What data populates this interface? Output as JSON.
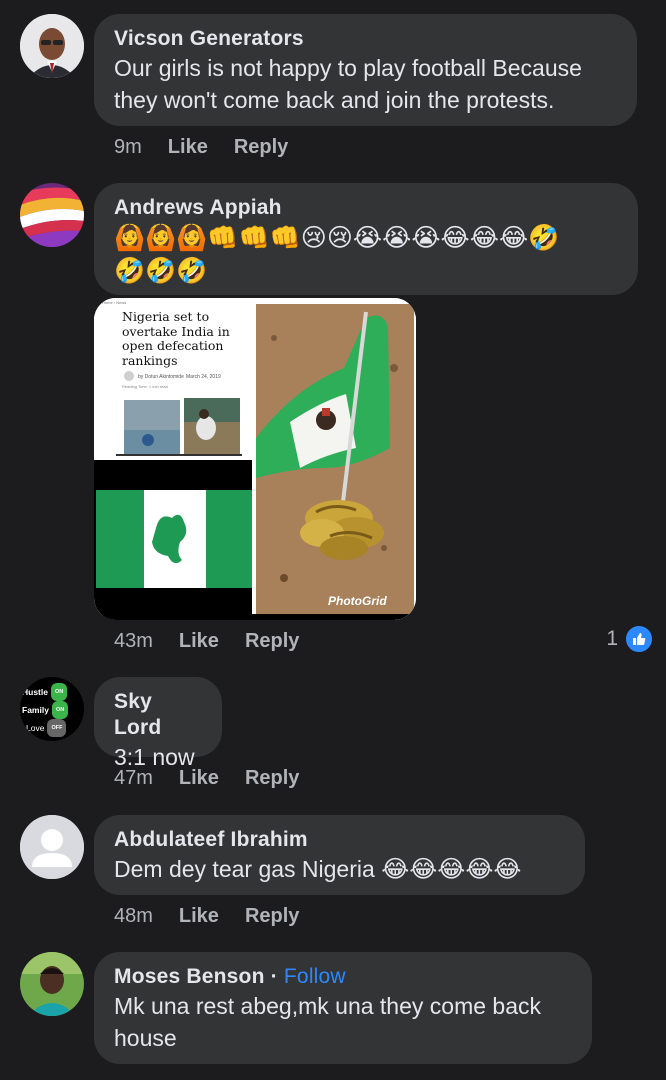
{
  "comments": [
    {
      "author": "Vicson Generators",
      "text_line1": "Our girls is not happy to play football Because",
      "text_line2": "they won't come back and join the protests.",
      "time": "9m",
      "like": "Like",
      "reply": "Reply"
    },
    {
      "author": "Andrews Appiah",
      "emoji_line1": "🙆🙆🙆👊👊👊😢😢😭😭😭😂😂😂🤣",
      "emoji_line2": "🤣🤣🤣",
      "time": "43m",
      "like": "Like",
      "reply": "Reply",
      "reaction_count": "1",
      "photo": {
        "article_breadcrumb": "Home › News",
        "headline": "Nigeria set to overtake India in open defecation rankings",
        "byline": "by Dotun Akintomide",
        "date": "March 24, 2019",
        "read_time": "Reading Time: 1 min read",
        "watermark": "PhotoGrid"
      }
    },
    {
      "author": "Sky Lord",
      "text_line1": "3:1 now",
      "time": "47m",
      "like": "Like",
      "reply": "Reply",
      "avatar_labels": [
        "Hustle",
        "Family",
        "Love"
      ],
      "avatar_toggles": [
        "ON",
        "ON",
        "OFF"
      ]
    },
    {
      "author": "Abdulateef Ibrahim",
      "text_line1": "Dem dey tear gas Nigeria",
      "emoji": "😂😂😂😂😂",
      "time": "48m",
      "like": "Like",
      "reply": "Reply"
    },
    {
      "author": "Moses Benson",
      "separator": "·",
      "follow": "Follow",
      "text_line1": "Mk una rest abeg,mk una they come back",
      "text_line2": "house"
    }
  ],
  "colors": {
    "background": "#1c1c1e",
    "bubble": "#333436",
    "text": "#e4e6eb",
    "secondary": "#b0b3b8",
    "accent": "#2d88ff",
    "flag_green": "#1f9a55"
  }
}
